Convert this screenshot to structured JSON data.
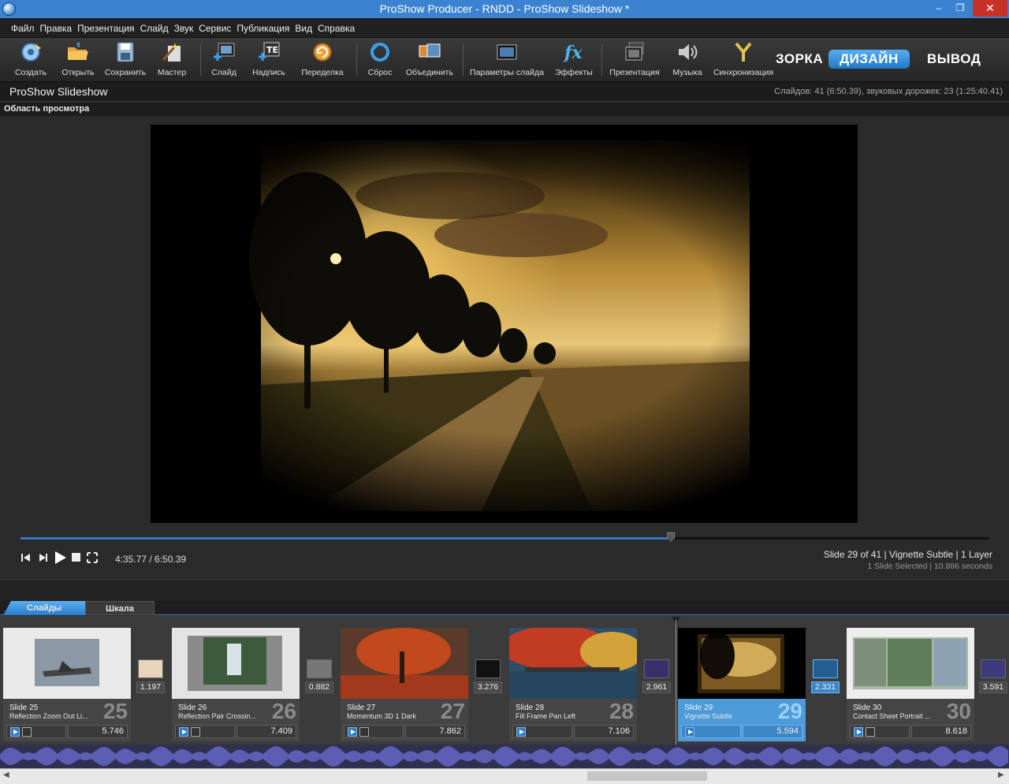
{
  "window": {
    "title": "ProShow Producer - RNDD - ProShow Slideshow *",
    "minimize_glyph": "–",
    "restore_glyph": "❐",
    "close_glyph": "✕"
  },
  "menu": [
    "Файл",
    "Правка",
    "Презентация",
    "Слайд",
    "Звук",
    "Сервис",
    "Публикация",
    "Вид",
    "Справка"
  ],
  "toolbar": {
    "create": "Создать",
    "open": "Открыть",
    "save": "Сохранить",
    "wizard": "Мастер",
    "slide": "Слайд",
    "caption": "Надпись",
    "remake": "Переделка",
    "reset": "Сброс",
    "merge": "Объединить",
    "slide_options": "Параметры слайда",
    "effects": "Эффекты",
    "show": "Презентация",
    "music": "Музыка",
    "sync": "Синхронизация"
  },
  "modes": {
    "build": "ЗОРКА",
    "design": "ДИЗАЙН",
    "output": "ВЫВОД"
  },
  "project": {
    "name": "ProShow Slideshow",
    "stats": "Слайдов: 41 (6:50.39), звуковых дорожек: 23 (1:25:40.41)"
  },
  "preview": {
    "label": "Область просмотра",
    "time": "4:35.77 / 6:50.39",
    "progress": 0.672,
    "info_line1": "Slide 29 of 41  |  Vignette Subtle  |  1 Layer",
    "info_line2": "1 Slide Selected  |  10.886 seconds"
  },
  "tabs": {
    "slides": "Слайды",
    "timeline": "Шкала"
  },
  "slides": [
    {
      "name": "Slide 25",
      "effect": "Reflection Zoom Out Li...",
      "number": "25",
      "duration": "5.746",
      "selected": false
    },
    {
      "name": "Slide 26",
      "effect": "Reflection Pair Crossin...",
      "number": "26",
      "duration": "7.409",
      "selected": false
    },
    {
      "name": "Slide 27",
      "effect": "Momentum 3D 1 Dark",
      "number": "27",
      "duration": "7.862",
      "selected": false
    },
    {
      "name": "Slide 28",
      "effect": "Fill Frame Pan Left",
      "number": "28",
      "duration": "7.106",
      "selected": false
    },
    {
      "name": "Slide 29",
      "effect": "Vignette Subtle",
      "number": "29",
      "duration": "5.594",
      "selected": true
    },
    {
      "name": "Slide 30",
      "effect": "Contact Sheet Portrait ...",
      "number": "30",
      "duration": "8.618",
      "selected": false
    }
  ],
  "transitions": [
    "1.197",
    "0.882",
    "3.276",
    "2.961",
    "2.331",
    "3.591"
  ],
  "colors": {
    "accent": "#3b83d0",
    "selected": "#4d9bd9",
    "close": "#c7312a"
  }
}
